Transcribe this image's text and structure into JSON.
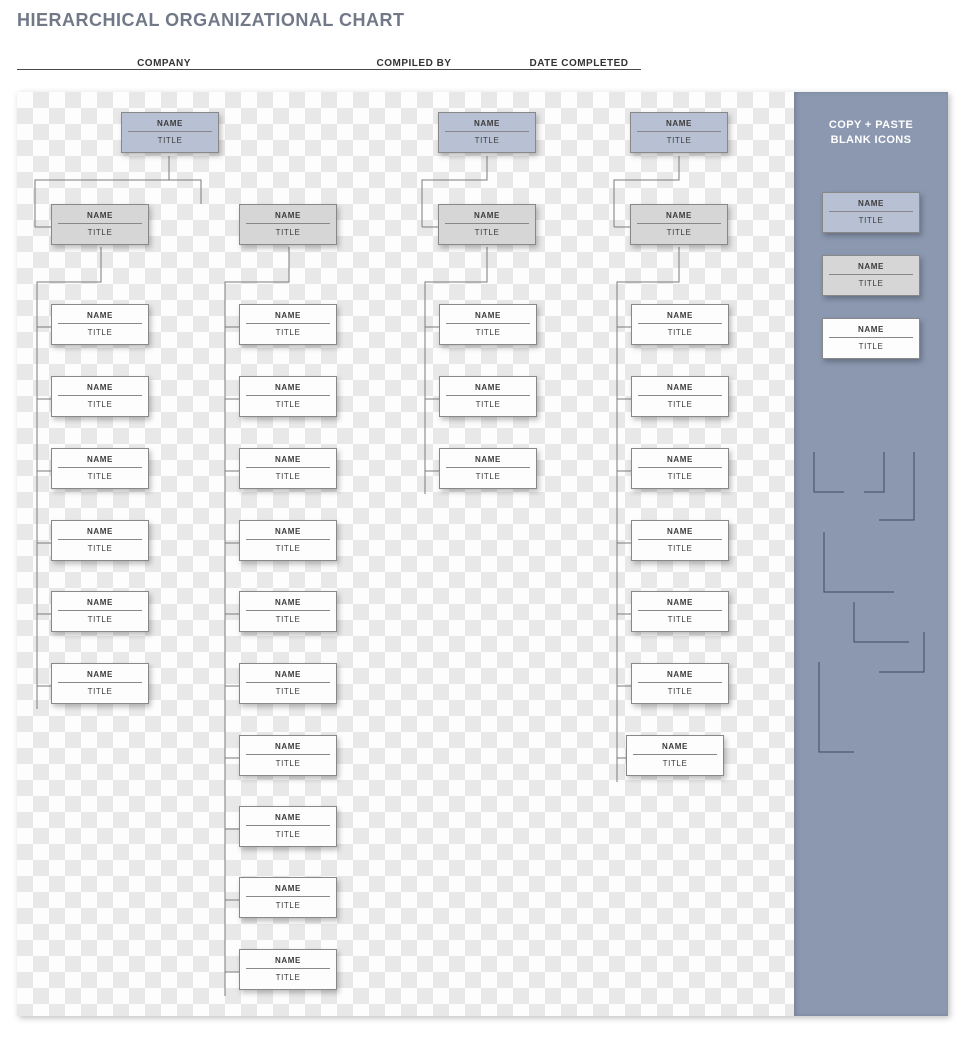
{
  "header": {
    "title": "HIERARCHICAL ORGANIZATIONAL CHART",
    "company_label": "COMPANY",
    "compiled_label": "COMPILED BY",
    "date_label": "DATE COMPLETED"
  },
  "sidebar": {
    "title_l1": "COPY + PASTE",
    "title_l2": "BLANK ICONS",
    "samples": [
      {
        "style": "blue",
        "name": "NAME",
        "title": "TITLE"
      },
      {
        "style": "grey",
        "name": "NAME",
        "title": "TITLE"
      },
      {
        "style": "white",
        "name": "NAME",
        "title": "TITLE"
      }
    ]
  },
  "placeholder": {
    "name": "NAME",
    "title": "TITLE"
  },
  "tree": {
    "group1": {
      "top": {
        "name": "NAME",
        "title": "TITLE"
      },
      "mid": [
        {
          "name": "NAME",
          "title": "TITLE"
        },
        {
          "name": "NAME",
          "title": "TITLE"
        }
      ],
      "leavesA": [
        {
          "name": "NAME",
          "title": "TITLE"
        },
        {
          "name": "NAME",
          "title": "TITLE"
        },
        {
          "name": "NAME",
          "title": "TITLE"
        },
        {
          "name": "NAME",
          "title": "TITLE"
        },
        {
          "name": "NAME",
          "title": "TITLE"
        },
        {
          "name": "NAME",
          "title": "TITLE"
        }
      ],
      "leavesB": [
        {
          "name": "NAME",
          "title": "TITLE"
        },
        {
          "name": "NAME",
          "title": "TITLE"
        },
        {
          "name": "NAME",
          "title": "TITLE"
        },
        {
          "name": "NAME",
          "title": "TITLE"
        },
        {
          "name": "NAME",
          "title": "TITLE"
        },
        {
          "name": "NAME",
          "title": "TITLE"
        },
        {
          "name": "NAME",
          "title": "TITLE"
        },
        {
          "name": "NAME",
          "title": "TITLE"
        },
        {
          "name": "NAME",
          "title": "TITLE"
        },
        {
          "name": "NAME",
          "title": "TITLE"
        }
      ]
    },
    "group2": {
      "top": {
        "name": "NAME",
        "title": "TITLE"
      },
      "mid": {
        "name": "NAME",
        "title": "TITLE"
      },
      "leaves": [
        {
          "name": "NAME",
          "title": "TITLE"
        },
        {
          "name": "NAME",
          "title": "TITLE"
        },
        {
          "name": "NAME",
          "title": "TITLE"
        }
      ]
    },
    "group3": {
      "top": {
        "name": "NAME",
        "title": "TITLE"
      },
      "mid": {
        "name": "NAME",
        "title": "TITLE"
      },
      "leaves": [
        {
          "name": "NAME",
          "title": "TITLE"
        },
        {
          "name": "NAME",
          "title": "TITLE"
        },
        {
          "name": "NAME",
          "title": "TITLE"
        },
        {
          "name": "NAME",
          "title": "TITLE"
        },
        {
          "name": "NAME",
          "title": "TITLE"
        },
        {
          "name": "NAME",
          "title": "TITLE"
        },
        {
          "name": "NAME",
          "title": "TITLE"
        }
      ]
    }
  }
}
